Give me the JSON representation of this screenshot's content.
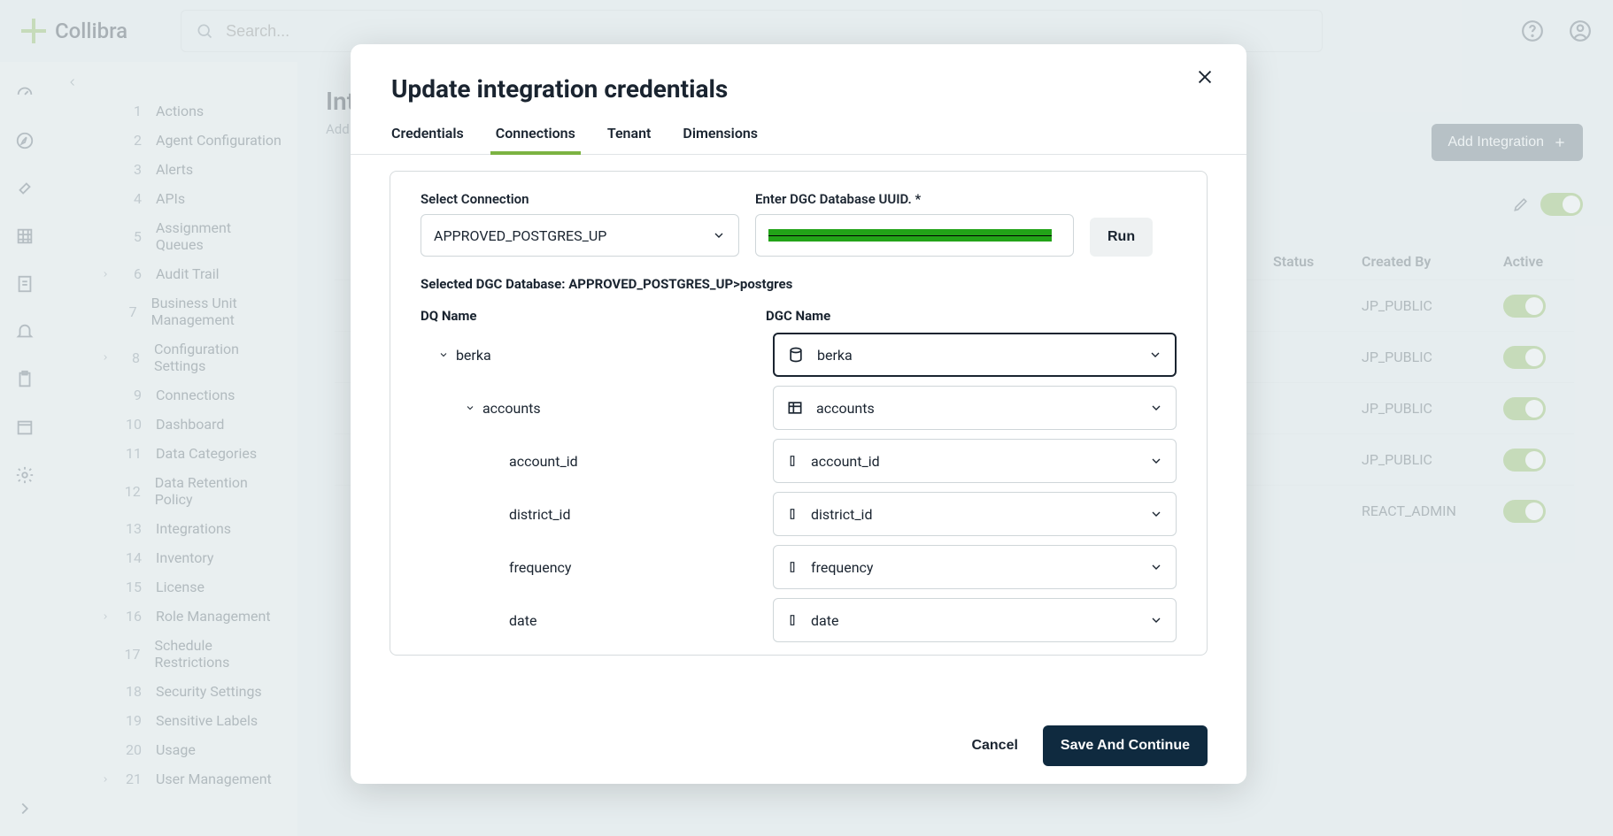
{
  "brand": "Collibra",
  "search": {
    "placeholder": "Search..."
  },
  "sidebar": {
    "items": [
      {
        "n": "1",
        "label": "Actions"
      },
      {
        "n": "2",
        "label": "Agent Configuration"
      },
      {
        "n": "3",
        "label": "Alerts"
      },
      {
        "n": "4",
        "label": "APIs"
      },
      {
        "n": "5",
        "label": "Assignment Queues"
      },
      {
        "n": "6",
        "label": "Audit Trail",
        "expandable": true
      },
      {
        "n": "7",
        "label": "Business Unit Management"
      },
      {
        "n": "8",
        "label": "Configuration Settings",
        "expandable": true
      },
      {
        "n": "9",
        "label": "Connections"
      },
      {
        "n": "10",
        "label": "Dashboard"
      },
      {
        "n": "11",
        "label": "Data Categories"
      },
      {
        "n": "12",
        "label": "Data Retention Policy"
      },
      {
        "n": "13",
        "label": "Integrations"
      },
      {
        "n": "14",
        "label": "Inventory"
      },
      {
        "n": "15",
        "label": "License"
      },
      {
        "n": "16",
        "label": "Role Management",
        "expandable": true
      },
      {
        "n": "17",
        "label": "Schedule Restrictions"
      },
      {
        "n": "18",
        "label": "Security Settings"
      },
      {
        "n": "19",
        "label": "Sensitive Labels"
      },
      {
        "n": "20",
        "label": "Usage"
      },
      {
        "n": "21",
        "label": "User Management",
        "expandable": true
      }
    ]
  },
  "page": {
    "title_prefix": "Int",
    "subtitle_prefix": "Add a"
  },
  "buttons": {
    "add_integration": "Add Integration"
  },
  "table": {
    "cols": {
      "status": "Status",
      "created_by": "Created By",
      "active": "Active"
    },
    "rows": [
      {
        "created_by": "JP_PUBLIC"
      },
      {
        "created_by": "JP_PUBLIC"
      },
      {
        "created_by": "JP_PUBLIC"
      },
      {
        "created_by": "JP_PUBLIC"
      },
      {
        "created_by": "REACT_ADMIN"
      }
    ]
  },
  "modal": {
    "title": "Update integration credentials",
    "tabs": [
      "Credentials",
      "Connections",
      "Tenant",
      "Dimensions"
    ],
    "active_tab": 1,
    "select_connection_label": "Select Connection",
    "select_connection_value": "APPROVED_POSTGRES_UP",
    "uuid_label": "Enter DGC Database UUID. *",
    "run_label": "Run",
    "selected_db_prefix": "Selected DGC Database: ",
    "selected_db_value": "APPROVED_POSTGRES_UP>postgres",
    "dq_name_header": "DQ Name",
    "dgc_name_header": "DGC Name",
    "tree": {
      "schema": {
        "dq": "berka",
        "dgc": "berka",
        "icon": "database"
      },
      "table": {
        "dq": "accounts",
        "dgc": "accounts",
        "icon": "table"
      },
      "columns": [
        {
          "dq": "account_id",
          "dgc": "account_id"
        },
        {
          "dq": "district_id",
          "dgc": "district_id"
        },
        {
          "dq": "frequency",
          "dgc": "frequency"
        },
        {
          "dq": "date",
          "dgc": "date"
        }
      ]
    },
    "cancel_label": "Cancel",
    "save_label": "Save And Continue"
  }
}
